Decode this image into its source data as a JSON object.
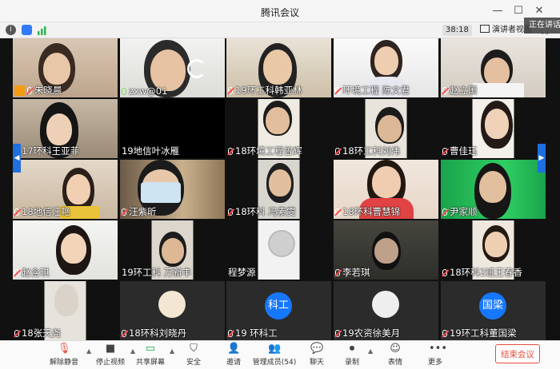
{
  "window": {
    "title": "腾讯会议"
  },
  "infobar": {
    "timer": "38:18",
    "view_label": "演讲者视图"
  },
  "speaking_label": "正在讲话：",
  "participants": [
    {
      "name": "朱晓晨",
      "mic": "muted",
      "host": true
    },
    {
      "name": "zxw@01",
      "mic": "on"
    },
    {
      "name": "19环工科韩亚林",
      "mic": "muted"
    },
    {
      "name": "环境工程 陈文君",
      "mic": "muted"
    },
    {
      "name": "赵立国",
      "mic": "muted"
    },
    {
      "name": "17环科王亚菲",
      "mic": "muted"
    },
    {
      "name": "19地信叶冰雁",
      "mic": "none"
    },
    {
      "name": "18环境工程曾辉",
      "mic": "muted"
    },
    {
      "name": "18环工科刘伟",
      "mic": "muted"
    },
    {
      "name": "曹佳珏",
      "mic": "muted"
    },
    {
      "name": "18地信汪艳",
      "mic": "muted"
    },
    {
      "name": "汪紫昕",
      "mic": "muted"
    },
    {
      "name": "18环科 冯素雯",
      "mic": "muted"
    },
    {
      "name": "18环科曹慧锦",
      "mic": "muted"
    },
    {
      "name": "尹家顺",
      "mic": "muted"
    },
    {
      "name": "赵含琪",
      "mic": "muted"
    },
    {
      "name": "19环工科 万新丰",
      "mic": "none"
    },
    {
      "name": "程梦源",
      "mic": "none"
    },
    {
      "name": "李若琪",
      "mic": "muted"
    },
    {
      "name": "18环科2班王春香",
      "mic": "muted"
    },
    {
      "name": "18张天尧",
      "mic": "muted"
    },
    {
      "name": "18环科刘晓丹",
      "mic": "muted"
    },
    {
      "name": "19 环科工",
      "mic": "muted",
      "avatar_text": "科工"
    },
    {
      "name": "19农资徐美月",
      "mic": "muted"
    },
    {
      "name": "19环工科董国梁",
      "mic": "muted",
      "avatar_text": "国梁"
    }
  ],
  "toolbar": {
    "unmute": "解除静音",
    "stop_video": "停止视频",
    "share_screen": "共享屏幕",
    "security": "安全",
    "invite": "邀请",
    "members": "管理成员(54)",
    "chat": "聊天",
    "record": "录制",
    "reactions": "表情",
    "more": "更多",
    "end_meeting": "结束会议"
  }
}
